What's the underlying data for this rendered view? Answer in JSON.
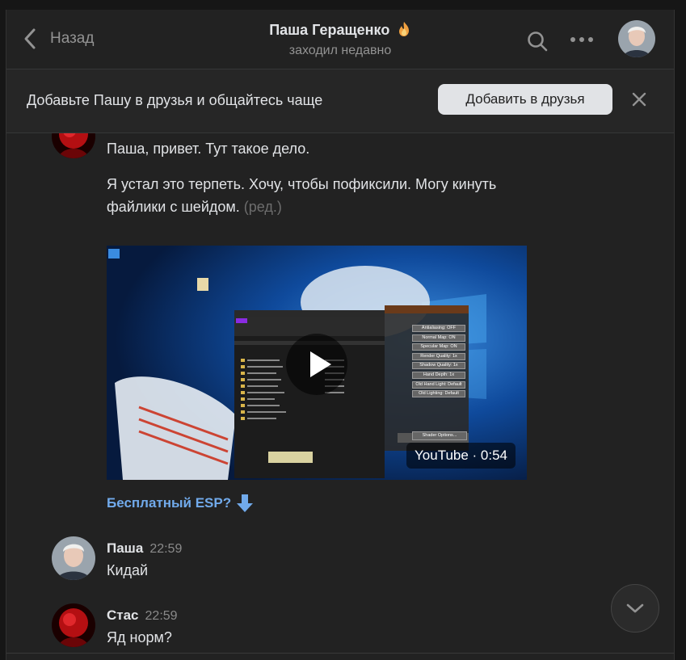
{
  "header": {
    "back_label": "Назад",
    "title": "Паша Геращенко",
    "status": "заходил недавно"
  },
  "banner": {
    "text": "Добавьте Пашу в друзья и общайтесь чаще",
    "add_button": "Добавить в друзья"
  },
  "messages": [
    {
      "text": "Паша, привет. Тут такое дело."
    },
    {
      "text": "Я устал это терпеть. Хочу, чтобы пофиксили. Могу кинуть",
      "text2": "файлики с шейдом.",
      "edited": "(ред.)"
    },
    {
      "video_badge": "YouTube · 0:54",
      "link": "Бесплатный ESP?"
    },
    {
      "author": "Паша",
      "time": "22:59",
      "text": "Кидай"
    },
    {
      "author": "Стас",
      "time": "22:59",
      "text": "Яд норм?"
    }
  ],
  "video": {
    "menu": [
      "Antialiasing: OFF",
      "Normal Map: ON",
      "Specular Map: ON",
      "Render Quality: 1x",
      "Shadow Quality: 1x",
      "Hand Depth: 1x",
      "Old Hand Light: Default",
      "Old Lighting: Default",
      "Shader Options..."
    ]
  },
  "colors": {
    "background": "#222222",
    "link": "#71aaeb",
    "button": "#e1e3e6"
  }
}
